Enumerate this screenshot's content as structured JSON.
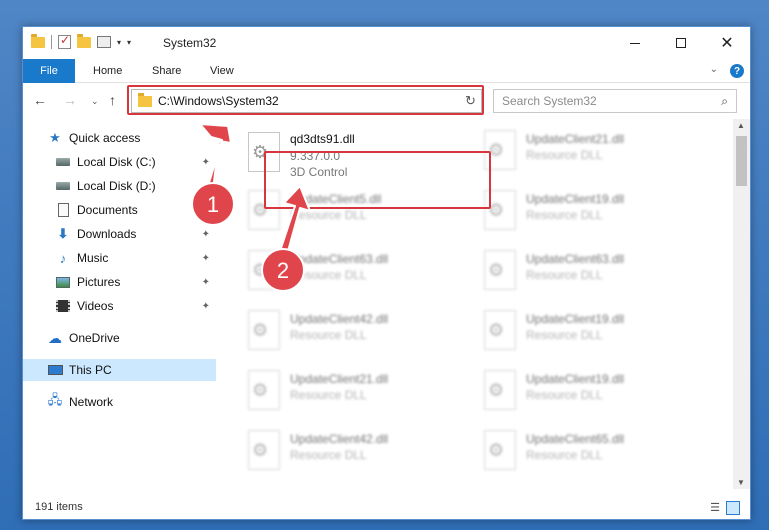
{
  "window": {
    "title": "System32",
    "controls": {
      "minimize": "—",
      "maximize": "",
      "close": "✕"
    }
  },
  "ribbon": {
    "tabs": [
      "File",
      "Home",
      "Share",
      "View"
    ],
    "expand": "⌄",
    "help": "?"
  },
  "nav": {
    "back": "←",
    "forward": "→",
    "recent": "⌄",
    "up": "↑",
    "address": "C:\\Windows\\System32",
    "address_drop": "⌄",
    "refresh": "↻",
    "search_placeholder": "Search System32",
    "search_icon": "⌕"
  },
  "sidebar": {
    "items": [
      {
        "label": "Quick access",
        "icon": "star-icon"
      },
      {
        "label": "Local Disk (C:)",
        "icon": "disk-icon",
        "pinned": true
      },
      {
        "label": "Local Disk (D:)",
        "icon": "disk-icon"
      },
      {
        "label": "Documents",
        "icon": "document-icon"
      },
      {
        "label": "Downloads",
        "icon": "download-icon",
        "pinned": true
      },
      {
        "label": "Music",
        "icon": "music-icon",
        "pinned": true
      },
      {
        "label": "Pictures",
        "icon": "pictures-icon",
        "pinned": true
      },
      {
        "label": "Videos",
        "icon": "videos-icon",
        "pinned": true
      },
      {
        "label": "OneDrive",
        "icon": "onedrive-icon"
      },
      {
        "label": "This PC",
        "icon": "pc-icon",
        "selected": true
      },
      {
        "label": "Network",
        "icon": "network-icon"
      }
    ],
    "pin_glyph": "📌"
  },
  "files": {
    "highlighted": {
      "name": "qd3dts91.dll",
      "version": "9.337.0.0",
      "description": "3D Control"
    },
    "blurred_left": [
      {
        "name": "UpdateClient5.dll",
        "type": "Resource DLL"
      },
      {
        "name": "UpdateClient63.dll",
        "type": "Resource DLL"
      },
      {
        "name": "UpdateClient42.dll",
        "type": "Resource DLL"
      },
      {
        "name": "UpdateClient21.dll",
        "type": "Resource DLL"
      },
      {
        "name": "UpdateClient42.dll",
        "type": "Resource DLL"
      }
    ],
    "blurred_right": [
      {
        "name": "UpdateClient21.dll",
        "type": "Resource DLL"
      },
      {
        "name": "UpdateClient19.dll",
        "type": "Resource DLL"
      },
      {
        "name": "UpdateClient63.dll",
        "type": "Resource DLL"
      },
      {
        "name": "UpdateClient19.dll",
        "type": "Resource DLL"
      },
      {
        "name": "UpdateClient19.dll",
        "type": "Resource DLL"
      },
      {
        "name": "UpdateClient65.dll",
        "type": "Resource DLL"
      }
    ]
  },
  "annotations": {
    "step1": "1",
    "step2": "2",
    "color": "#e0454b"
  },
  "status": {
    "item_count": "191 items"
  },
  "colors": {
    "accent": "#1979ca",
    "highlight": "#d6363c",
    "selected": "#cce8ff"
  }
}
